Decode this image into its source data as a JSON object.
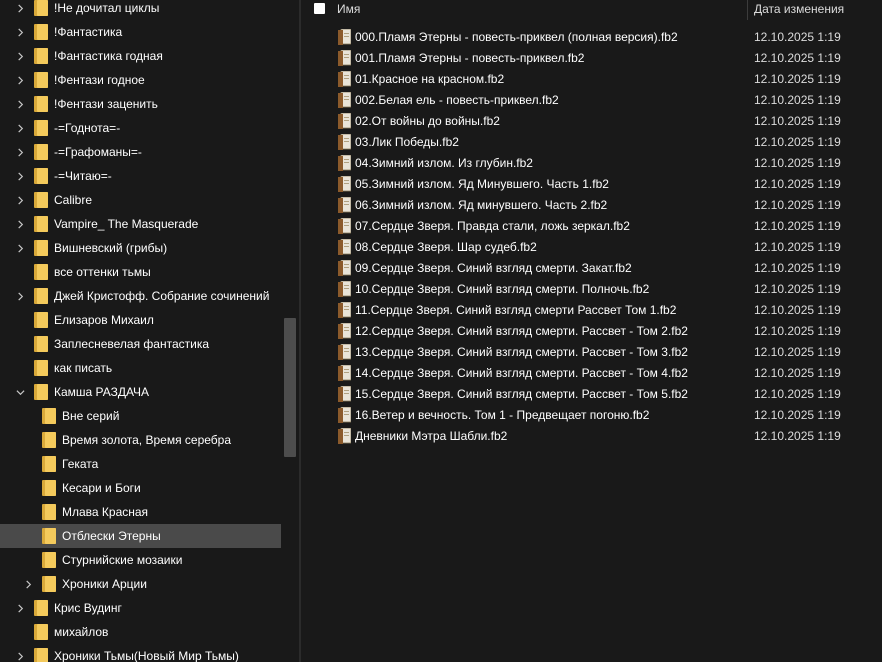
{
  "colors": {
    "background": "#191919",
    "selected_row": "#4a4a4a",
    "folder_yellow": "#f4ca5c",
    "text": "#ffffff"
  },
  "nav_tree": [
    {
      "label": "!Не дочитал циклы",
      "icon": "folder-icon",
      "expander": "chevron-right",
      "level": 0
    },
    {
      "label": "!Фантастика",
      "icon": "folder-icon",
      "expander": "chevron-right",
      "level": 0
    },
    {
      "label": "!Фантастика годная",
      "icon": "folder-icon",
      "expander": "chevron-right",
      "level": 0
    },
    {
      "label": "!Фентази годное",
      "icon": "folder-icon",
      "expander": "chevron-right",
      "level": 0
    },
    {
      "label": "!Фентази заценить",
      "icon": "folder-icon",
      "expander": "chevron-right",
      "level": 0
    },
    {
      "label": "-=Годнота=-",
      "icon": "folder-icon",
      "expander": "chevron-right",
      "level": 0
    },
    {
      "label": "-=Графоманы=-",
      "icon": "folder-icon",
      "expander": "chevron-right",
      "level": 0
    },
    {
      "label": "-=Читаю=-",
      "icon": "folder-icon",
      "expander": "chevron-right",
      "level": 0
    },
    {
      "label": "Calibre",
      "icon": "folder-icon",
      "expander": "chevron-right",
      "level": 0
    },
    {
      "label": "Vampire_ The Masquerade",
      "icon": "folder-icon",
      "expander": "chevron-right",
      "level": 0
    },
    {
      "label": "Вишневский (грибы)",
      "icon": "folder-icon",
      "expander": "chevron-right",
      "level": 0
    },
    {
      "label": "все оттенки тьмы",
      "icon": "folder-icon",
      "expander": "none",
      "level": 0
    },
    {
      "label": "Джей Кристофф. Собрание сочинений",
      "icon": "folder-icon",
      "expander": "chevron-right",
      "level": 0
    },
    {
      "label": "Елизаров Михаил",
      "icon": "folder-icon",
      "expander": "none",
      "level": 0
    },
    {
      "label": "Заплесневелая фантастика",
      "icon": "folder-icon",
      "expander": "none",
      "level": 0
    },
    {
      "label": "как писать",
      "icon": "folder-icon",
      "expander": "none",
      "level": 0
    },
    {
      "label": "Камша РАЗДАЧА",
      "icon": "folder-icon",
      "expander": "chevron-down",
      "level": 0
    },
    {
      "label": "Вне серий",
      "icon": "folder-icon",
      "expander": "none",
      "level": 1
    },
    {
      "label": "Время золота, Время серебра",
      "icon": "folder-icon",
      "expander": "none",
      "level": 1
    },
    {
      "label": "Геката",
      "icon": "folder-icon",
      "expander": "none",
      "level": 1
    },
    {
      "label": "Кесари и Боги",
      "icon": "folder-icon",
      "expander": "none",
      "level": 1
    },
    {
      "label": "Млава Красная",
      "icon": "folder-icon",
      "expander": "none",
      "level": 1
    },
    {
      "label": "Отблески Этерны",
      "icon": "folder-icon",
      "expander": "none",
      "level": 1,
      "selected": true
    },
    {
      "label": "Стурнийские мозаики",
      "icon": "folder-icon",
      "expander": "none",
      "level": 1
    },
    {
      "label": "Хроники Арции",
      "icon": "folder-icon",
      "expander": "chevron-right",
      "level": 1
    },
    {
      "label": "Крис Вудинг",
      "icon": "folder-icon",
      "expander": "chevron-right",
      "level": 0
    },
    {
      "label": "михайлов",
      "icon": "folder-icon",
      "expander": "none",
      "level": 0
    },
    {
      "label": "Хроники Тьмы(Новый Мир Тьмы)",
      "icon": "folder-icon",
      "expander": "chevron-right",
      "level": 0
    }
  ],
  "header": {
    "name_label": "Имя",
    "date_label": "Дата изменения"
  },
  "files": [
    {
      "name": "000.Пламя Этерны - повесть-приквел (полная версия).fb2",
      "date": "12.10.2025 1:19",
      "icon": "fb2-file-icon"
    },
    {
      "name": "001.Пламя Этерны - повесть-приквел.fb2",
      "date": "12.10.2025 1:19",
      "icon": "fb2-file-icon"
    },
    {
      "name": "01.Красное на красном.fb2",
      "date": "12.10.2025 1:19",
      "icon": "fb2-file-icon"
    },
    {
      "name": "002.Белая ель - повесть-приквел.fb2",
      "date": "12.10.2025 1:19",
      "icon": "fb2-file-icon"
    },
    {
      "name": "02.От войны до войны.fb2",
      "date": "12.10.2025 1:19",
      "icon": "fb2-file-icon"
    },
    {
      "name": "03.Лик Победы.fb2",
      "date": "12.10.2025 1:19",
      "icon": "fb2-file-icon"
    },
    {
      "name": "04.Зимний излом. Из глубин.fb2",
      "date": "12.10.2025 1:19",
      "icon": "fb2-file-icon"
    },
    {
      "name": "05.Зимний излом. Яд Минувшего. Часть 1.fb2",
      "date": "12.10.2025 1:19",
      "icon": "fb2-file-icon"
    },
    {
      "name": "06.Зимний излом. Яд минувшего. Часть 2.fb2",
      "date": "12.10.2025 1:19",
      "icon": "fb2-file-icon"
    },
    {
      "name": "07.Сердце Зверя. Правда стали, ложь зеркал.fb2",
      "date": "12.10.2025 1:19",
      "icon": "fb2-file-icon"
    },
    {
      "name": "08.Сердце Зверя. Шар судеб.fb2",
      "date": "12.10.2025 1:19",
      "icon": "fb2-file-icon"
    },
    {
      "name": "09.Сердце Зверя. Синий взгляд смерти. Закат.fb2",
      "date": "12.10.2025 1:19",
      "icon": "fb2-file-icon"
    },
    {
      "name": "10.Сердце Зверя. Синий взгляд смерти. Полночь.fb2",
      "date": "12.10.2025 1:19",
      "icon": "fb2-file-icon"
    },
    {
      "name": "11.Сердце Зверя. Синий взгляд смерти Рассвет Том 1.fb2",
      "date": "12.10.2025 1:19",
      "icon": "fb2-file-icon"
    },
    {
      "name": "12.Сердце Зверя. Синий взгляд смерти. Рассвет - Том 2.fb2",
      "date": "12.10.2025 1:19",
      "icon": "fb2-file-icon"
    },
    {
      "name": "13.Сердце Зверя. Синий взгляд смерти. Рассвет - Том 3.fb2",
      "date": "12.10.2025 1:19",
      "icon": "fb2-file-icon"
    },
    {
      "name": "14.Сердце Зверя. Синий взгляд смерти. Рассвет - Том 4.fb2",
      "date": "12.10.2025 1:19",
      "icon": "fb2-file-icon"
    },
    {
      "name": "15.Сердце Зверя. Синий взгляд смерти. Рассвет - Том 5.fb2",
      "date": "12.10.2025 1:19",
      "icon": "fb2-file-icon"
    },
    {
      "name": "16.Ветер и вечность. Том 1 - Предвещает погоню.fb2",
      "date": "12.10.2025 1:19",
      "icon": "fb2-file-icon"
    },
    {
      "name": "Дневники Мэтра Шабли.fb2",
      "date": "12.10.2025 1:19",
      "icon": "fb2-file-icon"
    }
  ]
}
